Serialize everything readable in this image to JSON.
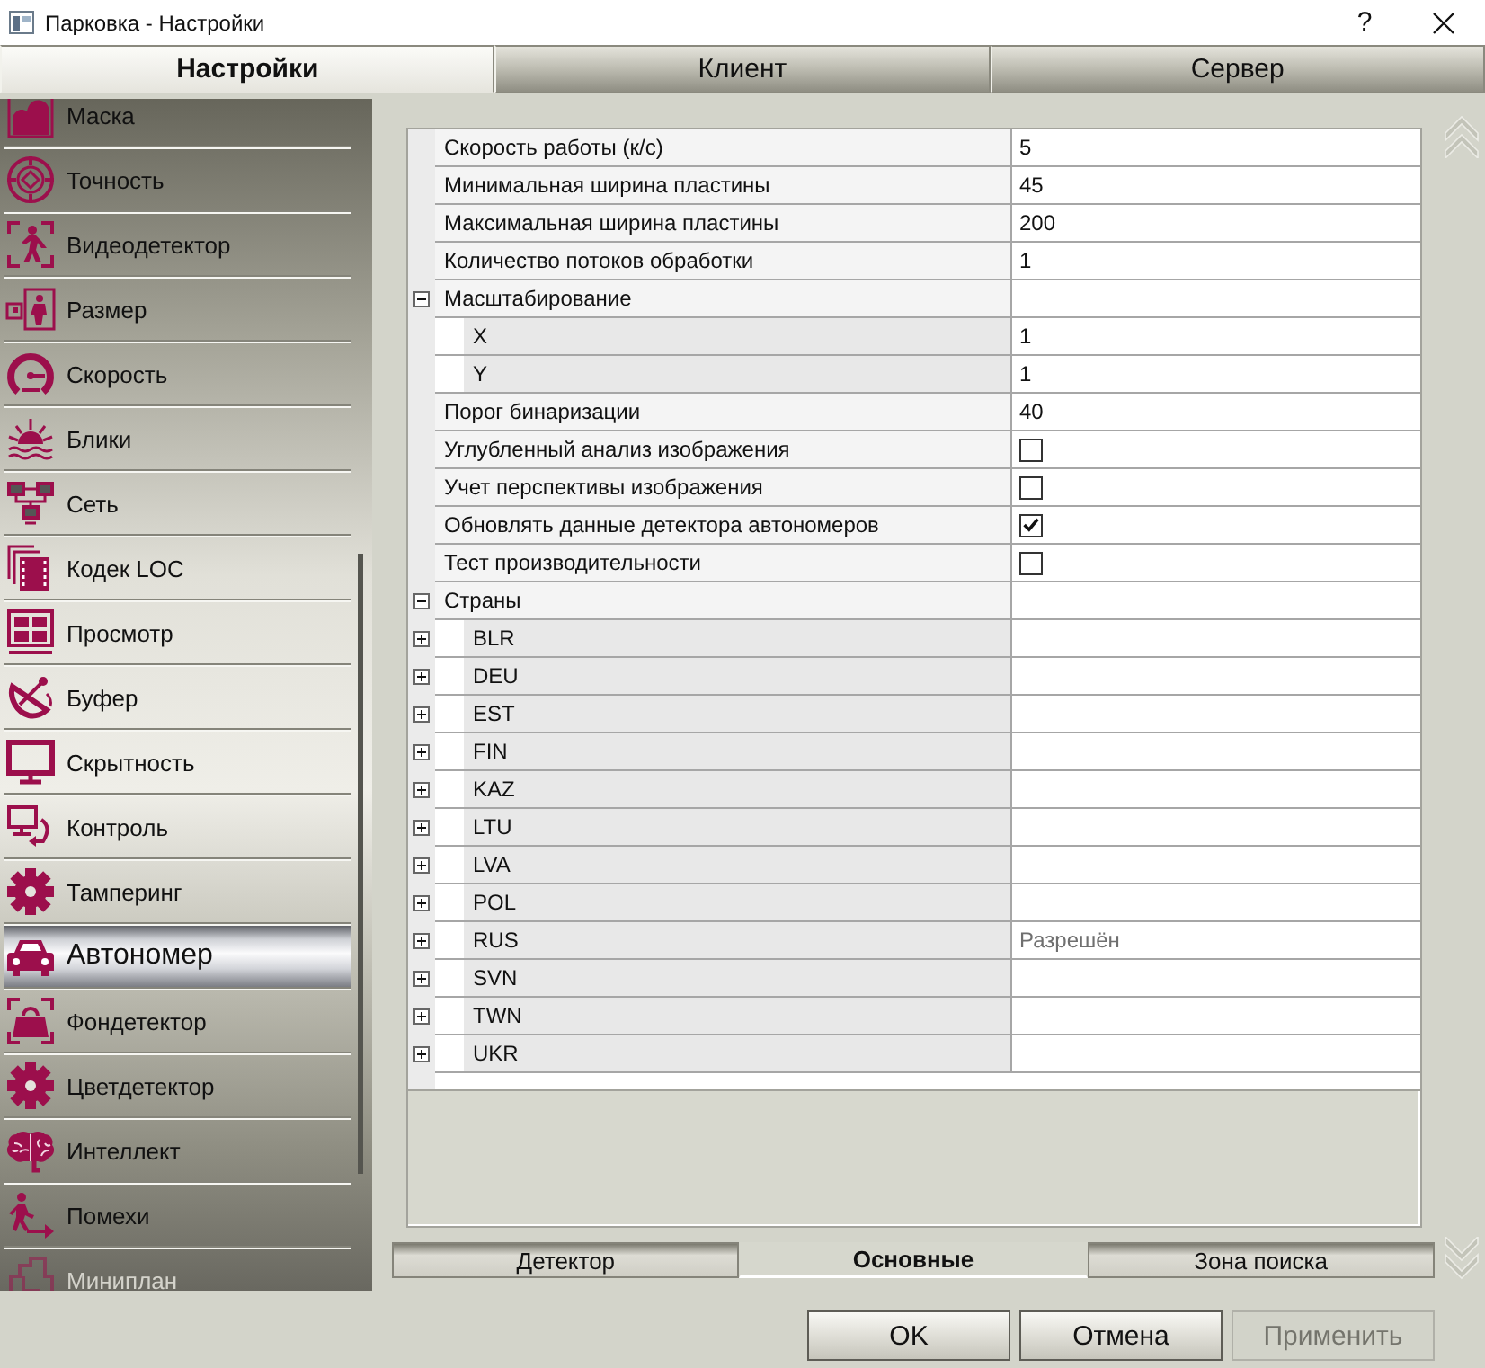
{
  "window": {
    "title": "Парковка - Настройки",
    "help_button": "?"
  },
  "tabs": [
    {
      "label": "Настройки",
      "selected": true
    },
    {
      "label": "Клиент",
      "selected": false
    },
    {
      "label": "Сервер",
      "selected": false
    }
  ],
  "sidebar": {
    "items": [
      {
        "label": "Маска",
        "selected": false,
        "disabled": false
      },
      {
        "label": "Точность",
        "selected": false,
        "disabled": false
      },
      {
        "label": "Видеодетектор",
        "selected": false,
        "disabled": false
      },
      {
        "label": "Размер",
        "selected": false,
        "disabled": false
      },
      {
        "label": "Скорость",
        "selected": false,
        "disabled": false
      },
      {
        "label": "Блики",
        "selected": false,
        "disabled": false
      },
      {
        "label": "Сеть",
        "selected": false,
        "disabled": false
      },
      {
        "label": "Кодек LOC",
        "selected": false,
        "disabled": false
      },
      {
        "label": "Просмотр",
        "selected": false,
        "disabled": false
      },
      {
        "label": "Буфер",
        "selected": false,
        "disabled": false
      },
      {
        "label": "Скрытность",
        "selected": false,
        "disabled": false
      },
      {
        "label": "Контроль",
        "selected": false,
        "disabled": false
      },
      {
        "label": "Тамперинг",
        "selected": false,
        "disabled": false
      },
      {
        "label": "Автономер",
        "selected": true,
        "disabled": false
      },
      {
        "label": "Фондетектор",
        "selected": false,
        "disabled": false
      },
      {
        "label": "Цветдетектор",
        "selected": false,
        "disabled": false
      },
      {
        "label": "Интеллект",
        "selected": false,
        "disabled": false
      },
      {
        "label": "Помехи",
        "selected": false,
        "disabled": false
      },
      {
        "label": "Миниплан",
        "selected": false,
        "disabled": true
      }
    ]
  },
  "properties": {
    "rows": [
      {
        "kind": "text",
        "name": "Скорость работы (к/с)",
        "value": "5"
      },
      {
        "kind": "text",
        "name": "Минимальная ширина пластины",
        "value": "45"
      },
      {
        "kind": "text",
        "name": "Максимальная ширина пластины",
        "value": "200"
      },
      {
        "kind": "text",
        "name": "Количество потоков обработки",
        "value": "1"
      },
      {
        "kind": "group",
        "name": "Масштабирование",
        "expanded": true,
        "children": [
          {
            "kind": "text",
            "name": "X",
            "value": "1"
          },
          {
            "kind": "text",
            "name": "Y",
            "value": "1"
          }
        ]
      },
      {
        "kind": "text",
        "name": "Порог бинаризации",
        "value": "40"
      },
      {
        "kind": "check",
        "name": "Углубленный анализ изображения",
        "checked": false
      },
      {
        "kind": "check",
        "name": "Учет перспективы изображения",
        "checked": false
      },
      {
        "kind": "check",
        "name": "Обновлять данные детектора автономеров",
        "checked": true
      },
      {
        "kind": "check",
        "name": "Тест производительности",
        "checked": false
      },
      {
        "kind": "group",
        "name": "Страны",
        "expanded": true,
        "children": [
          {
            "kind": "group",
            "name": "BLR",
            "expanded": false
          },
          {
            "kind": "group",
            "name": "DEU",
            "expanded": false
          },
          {
            "kind": "group",
            "name": "EST",
            "expanded": false
          },
          {
            "kind": "group",
            "name": "FIN",
            "expanded": false
          },
          {
            "kind": "group",
            "name": "KAZ",
            "expanded": false
          },
          {
            "kind": "group",
            "name": "LTU",
            "expanded": false
          },
          {
            "kind": "group",
            "name": "LVA",
            "expanded": false
          },
          {
            "kind": "group",
            "name": "POL",
            "expanded": false
          },
          {
            "kind": "group",
            "name": "RUS",
            "expanded": false,
            "value": "Разрешён"
          },
          {
            "kind": "group",
            "name": "SVN",
            "expanded": false
          },
          {
            "kind": "group",
            "name": "TWN",
            "expanded": false
          },
          {
            "kind": "group",
            "name": "UKR",
            "expanded": false
          }
        ]
      }
    ]
  },
  "subtabs": [
    {
      "label": "Детектор",
      "selected": false
    },
    {
      "label": "Основные",
      "selected": true
    },
    {
      "label": "Зона поиска",
      "selected": false
    }
  ],
  "buttons": [
    {
      "label": "OK",
      "disabled": false
    },
    {
      "label": "Отмена",
      "disabled": false
    },
    {
      "label": "Применить",
      "disabled": true
    }
  ]
}
